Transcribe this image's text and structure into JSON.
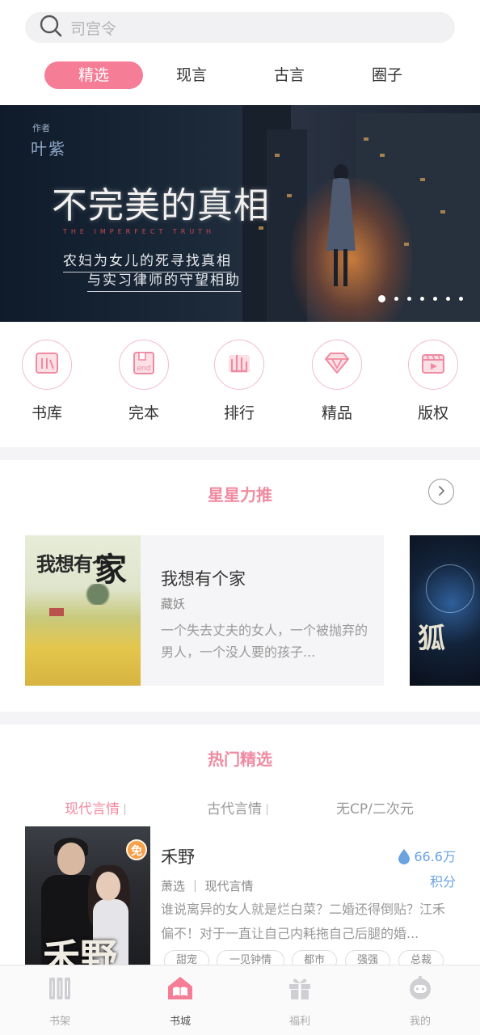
{
  "search": {
    "placeholder": "司宫令"
  },
  "tabs": [
    {
      "label": "精选",
      "active": true
    },
    {
      "label": "现言"
    },
    {
      "label": "古言"
    },
    {
      "label": "圈子"
    }
  ],
  "banner": {
    "author_tag": "作者",
    "author": "叶紫",
    "title": "不完美的真相",
    "subtitle_en": "THE IMPERFECT TRUTH",
    "line1": "农妇为女儿的死寻找真相",
    "line2": "与实习律师的守望相助",
    "slide_count": 7,
    "active_slide": 1
  },
  "categories": [
    {
      "label": "书库",
      "icon": "library-icon"
    },
    {
      "label": "完本",
      "icon": "finished-icon"
    },
    {
      "label": "排行",
      "icon": "ranking-icon"
    },
    {
      "label": "精品",
      "icon": "diamond-icon"
    },
    {
      "label": "版权",
      "icon": "copyright-icon"
    }
  ],
  "recommend": {
    "title": "星星力推",
    "book": {
      "title": "我想有个家",
      "author": "藏妖",
      "desc": "一个失去丈夫的女人，一个被抛弃的男人，一个没人要的孩子...",
      "cover_text_1": "我想有个",
      "cover_text_2": "家"
    },
    "next_cover_text": "狐"
  },
  "hot": {
    "title": "热门精选",
    "subtabs": [
      {
        "label": "现代言情",
        "active": true
      },
      {
        "label": "古代言情"
      },
      {
        "label": "无CP/二次元"
      }
    ],
    "book": {
      "title": "禾野",
      "meta": "萧选 ｜ 现代言情",
      "desc": "谁说离异的女人就是烂白菜？二婚还得倒贴？江禾偏不！对于一直让自己内耗拖自己后腿的婚...",
      "score": "66.6万",
      "score_unit": "积分",
      "free_badge": "免",
      "cover_text": "禾野",
      "tags": [
        "甜宠",
        "一见钟情",
        "都市",
        "强强",
        "总裁"
      ]
    }
  },
  "bottom_nav": [
    {
      "label": "书架",
      "icon": "bookshelf-icon"
    },
    {
      "label": "书城",
      "icon": "bookstore-icon",
      "active": true
    },
    {
      "label": "福利",
      "icon": "gift-icon"
    },
    {
      "label": "我的",
      "icon": "profile-icon"
    }
  ],
  "colors": {
    "accent": "#f57d96",
    "accent_text": "#f08aa0",
    "score": "#6aa3e0",
    "gray_bg": "#f4f4f6"
  }
}
